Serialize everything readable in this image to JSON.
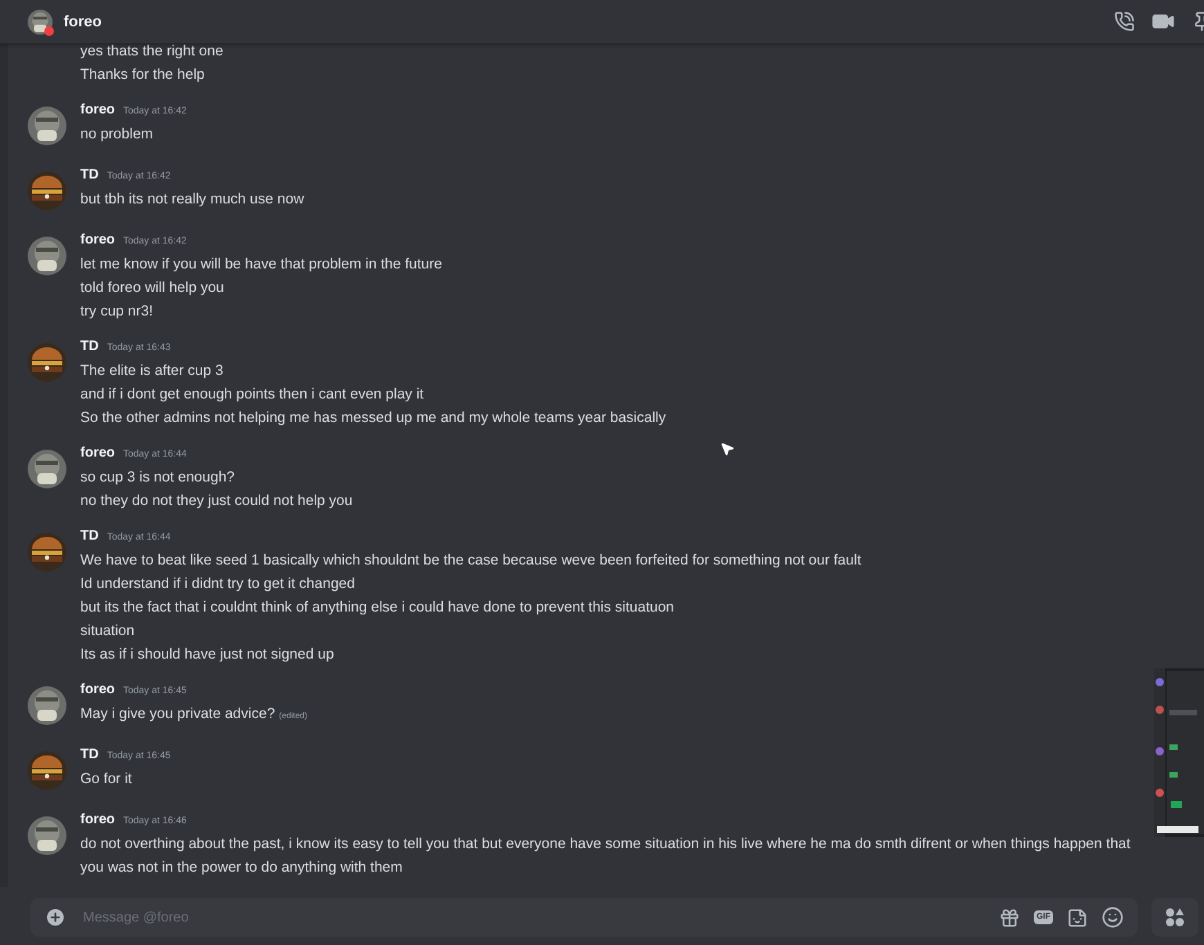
{
  "header": {
    "title": "foreo",
    "color": "#f23f43"
  },
  "messages": [
    {
      "kind": "continuation",
      "lines": [
        {
          "text": "yes thats the right one"
        },
        {
          "text": "Thanks for the help"
        }
      ]
    },
    {
      "kind": "foreo",
      "author": "foreo",
      "time": "Today at 16:42",
      "lines": [
        {
          "text": "no problem"
        }
      ]
    },
    {
      "kind": "td",
      "author": "TD",
      "time": "Today at 16:42",
      "lines": [
        {
          "text": "but tbh its not really much use now"
        }
      ]
    },
    {
      "kind": "foreo",
      "author": "foreo",
      "time": "Today at 16:42",
      "lines": [
        {
          "text": "let me know if you will be have that problem in the future"
        },
        {
          "text": "told foreo will help you"
        },
        {
          "text": "try cup nr3!"
        }
      ]
    },
    {
      "kind": "td",
      "author": "TD",
      "time": "Today at 16:43",
      "lines": [
        {
          "text": "The elite is after cup 3"
        },
        {
          "text": "and if i dont get enough points then i cant even play it"
        },
        {
          "text": "So the other admins not helping me has messed up me and my whole teams year basically"
        }
      ]
    },
    {
      "kind": "foreo",
      "author": "foreo",
      "time": "Today at 16:44",
      "lines": [
        {
          "text": "so cup 3 is not enough?"
        },
        {
          "text": "no they do not they just could not help you"
        }
      ]
    },
    {
      "kind": "td",
      "author": "TD",
      "time": "Today at 16:44",
      "lines": [
        {
          "text": "We have to beat like seed 1 basically which shouldnt be the case because weve been forfeited for something not our fault"
        },
        {
          "text": "Id understand if i didnt try to get it changed"
        },
        {
          "text": "but its the fact that i couldnt think of anything else i could have done to prevent this situatuon"
        },
        {
          "text": "situation"
        },
        {
          "text": "Its as if i should have just not signed up"
        }
      ]
    },
    {
      "kind": "foreo",
      "author": "foreo",
      "time": "Today at 16:45",
      "lines": [
        {
          "text": "May i give you private advice?",
          "edited": "(edited)"
        }
      ]
    },
    {
      "kind": "td",
      "author": "TD",
      "time": "Today at 16:45",
      "lines": [
        {
          "text": "Go for it"
        }
      ]
    },
    {
      "kind": "foreo",
      "author": "foreo",
      "time": "Today at 16:46",
      "lines": [
        {
          "text": "do not overthing about the past, i know its easy to tell you that but everyone have some situation in his live where he ma do smth difrent or when things happen that you was not in the power to do anything with them"
        }
      ]
    }
  ],
  "composer": {
    "placeholder": "Message @foreo",
    "gif_label": "GIF"
  }
}
